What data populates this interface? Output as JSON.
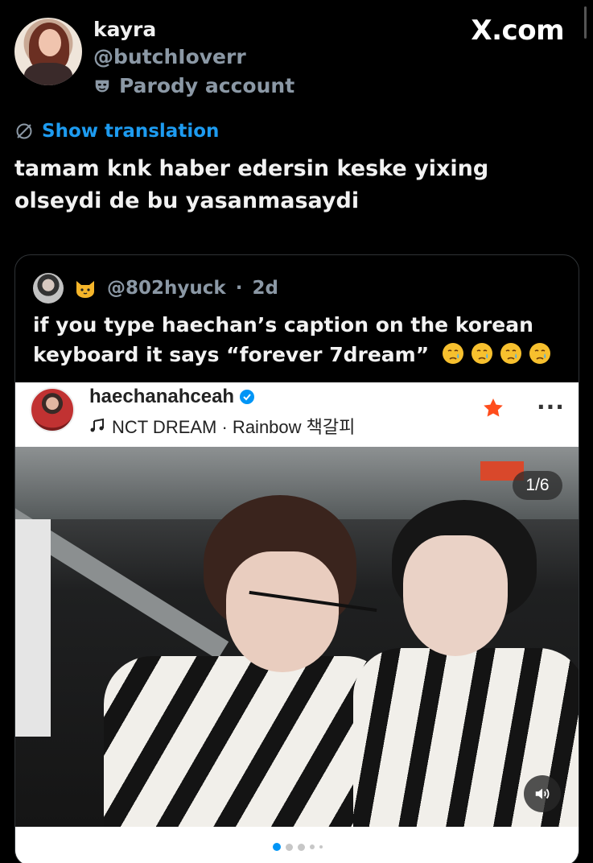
{
  "author": {
    "name": "kayra",
    "handle": "@butchIoverr",
    "label": "Parody account"
  },
  "brand": "X.com",
  "translate_label": "Show translation",
  "tweet_text": "tamam knk haber edersin keske yixing olseydi de bu yasanmasaydi",
  "quoted": {
    "handle": "@802hyuck",
    "time": "2d",
    "text": "if you type haechan’s caption on the korean keyboard it says “forever 7dream”",
    "embed": {
      "username": "haechanahceah",
      "music": "NCT DREAM · Rainbow 책갈피",
      "counter": "1/6",
      "slides": 6,
      "active_slide": 1
    }
  },
  "icons": {
    "mask": "mask-icon",
    "globe": "globe-icon",
    "cat": "cat-icon",
    "crying": "crying-face-icon",
    "verified": "verified-icon",
    "note": "music-note-icon",
    "star": "star-icon",
    "more": "more-icon",
    "sound": "sound-icon"
  },
  "colors": {
    "background": "#000000",
    "link": "#1d9bf0",
    "muted": "#8b98a5",
    "verified": "#0095f6",
    "star": "#ff4d1c"
  }
}
